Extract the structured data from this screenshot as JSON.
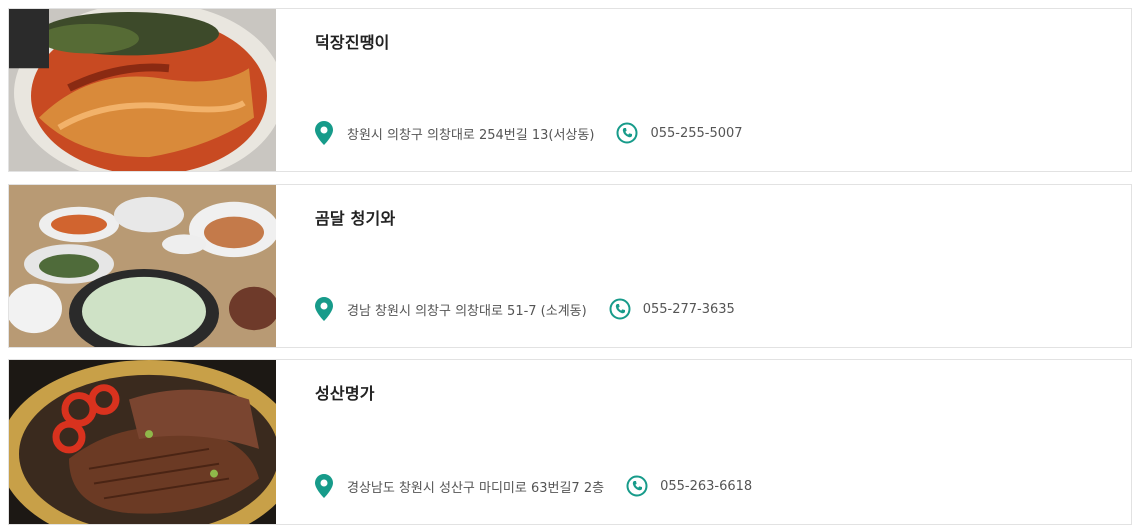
{
  "restaurants": [
    {
      "name": "덕장진땡이",
      "address": "창원시 의창구 의창대로 254번길 13(서상동)",
      "phone": "055-255-5007",
      "photo_icon": "braised-fish-photo"
    },
    {
      "name": "곰달 청기와",
      "address": "경남 창원시 의창구 의창대로 51-7 (소계동)",
      "phone": "055-277-3635",
      "photo_icon": "soup-set-photo"
    },
    {
      "name": "성산명가",
      "address": "경상남도 창원시 성산구 마디미로 63번길7 2층",
      "phone": "055-263-6618",
      "photo_icon": "grilled-beef-photo"
    }
  ],
  "colors": {
    "accent": "#179b8a",
    "text": "#555555",
    "title": "#222222"
  }
}
